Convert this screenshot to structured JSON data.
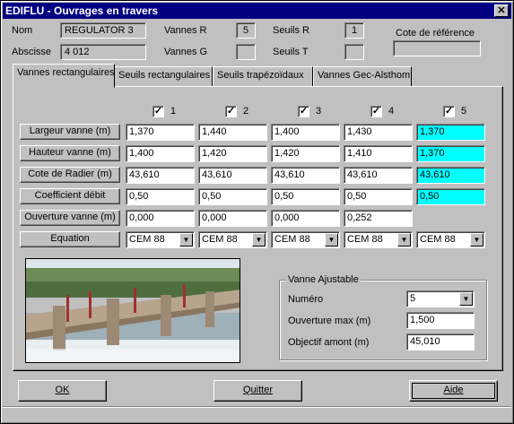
{
  "window": {
    "title": "EDIFLU - Ouvrages en travers"
  },
  "header": {
    "nom_label": "Nom",
    "nom_value": "REGULATOR 3",
    "abscisse_label": "Abscisse",
    "abscisse_value": "4 012",
    "vannes_r_label": "Vannes R",
    "vannes_r_value": "5",
    "vannes_g_label": "Vannes G",
    "vannes_g_value": "",
    "seuils_r_label": "Seuils R",
    "seuils_r_value": "1",
    "seuils_t_label": "Seuils T",
    "seuils_t_value": "",
    "cote_ref_label": "Cote de référence",
    "cote_ref_value": ""
  },
  "tabs": [
    {
      "label": "Vannes rectangulaires",
      "active": true
    },
    {
      "label": "Seuils rectangulaires",
      "active": false
    },
    {
      "label": "Seuils trapézoïdaux",
      "active": false
    },
    {
      "label": "Vannes Gec-Alsthom",
      "active": false
    }
  ],
  "columns": [
    "1",
    "2",
    "3",
    "4",
    "5"
  ],
  "rows": [
    {
      "label": "Largeur vanne (m)",
      "values": [
        "1,370",
        "1,440",
        "1,400",
        "1,430",
        "1,370"
      ]
    },
    {
      "label": "Hauteur vanne (m)",
      "values": [
        "1,400",
        "1,420",
        "1,420",
        "1,410",
        "1,370"
      ]
    },
    {
      "label": "Cote de Radier (m)",
      "values": [
        "43,610",
        "43,610",
        "43,610",
        "43,610",
        "43,610"
      ]
    },
    {
      "label": "Coefficient débit",
      "values": [
        "0,50",
        "0,50",
        "0,50",
        "0,50",
        "0,50"
      ]
    },
    {
      "label": "Ouverture vanne (m)",
      "values": [
        "0,000",
        "0,000",
        "0,000",
        "0,252",
        ""
      ]
    }
  ],
  "equation": {
    "label": "Equation",
    "values": [
      "CEM 88",
      "CEM 88",
      "CEM 88",
      "CEM 88",
      "CEM 88"
    ]
  },
  "colors": {
    "highlight": "#00ffff",
    "titlebar": "#000080"
  },
  "vanne_ajustable": {
    "title": "Vanne Ajustable",
    "numero_label": "Numéro",
    "numero_value": "5",
    "ouverture_max_label": "Ouverture max (m)",
    "ouverture_max_value": "1,500",
    "objectif_label": "Objectif amont (m)",
    "objectif_value": "45,010"
  },
  "buttons": {
    "ok": "OK",
    "quitter": "Quitter",
    "aide": "Aide"
  },
  "icons": {
    "close": "close-icon",
    "dropdown": "chevron-down-icon",
    "check": "check-icon"
  }
}
